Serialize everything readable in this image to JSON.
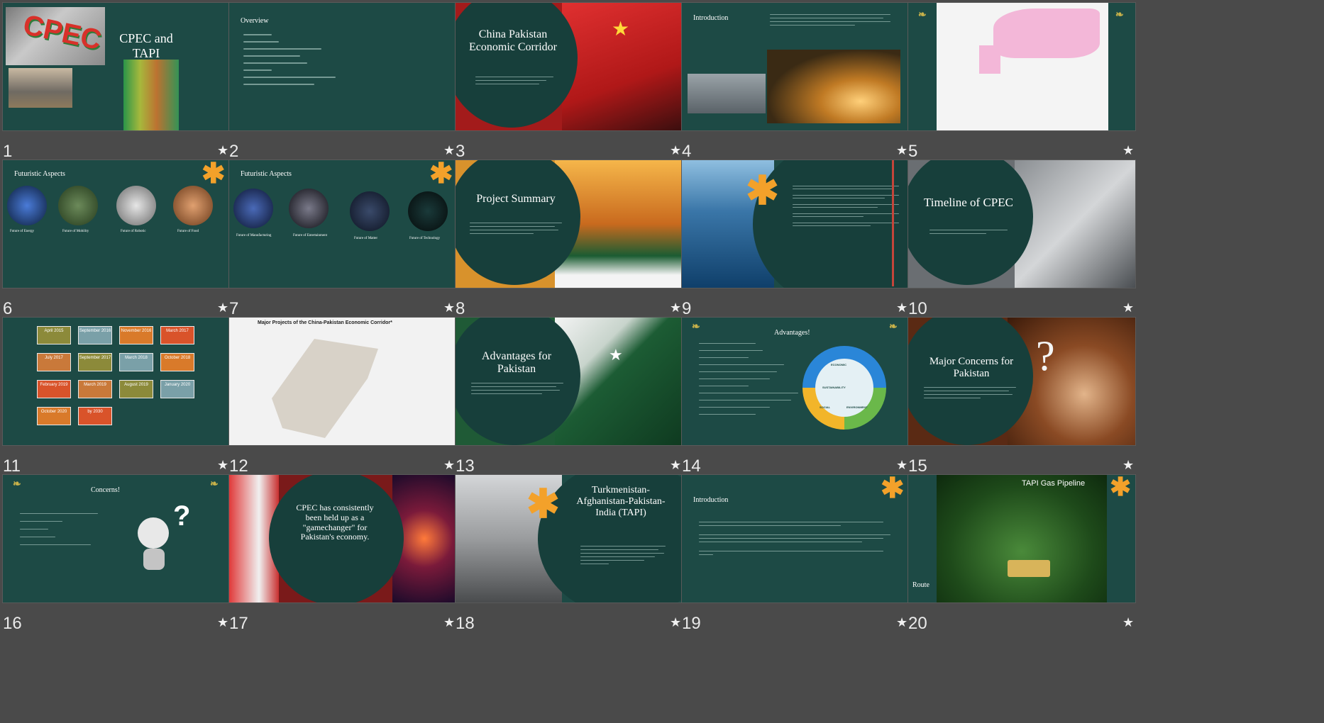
{
  "slides": [
    {
      "num": "1",
      "title": "CPEC and TAPI"
    },
    {
      "num": "2",
      "title": "Overview"
    },
    {
      "num": "3",
      "title": "China Pakistan Economic Corridor"
    },
    {
      "num": "4",
      "title": "Introduction"
    },
    {
      "num": "5",
      "title": ""
    },
    {
      "num": "6",
      "title": "Futuristic Aspects"
    },
    {
      "num": "7",
      "title": "Futuristic Aspects"
    },
    {
      "num": "8",
      "title": "Project Summary"
    },
    {
      "num": "9",
      "title": ""
    },
    {
      "num": "10",
      "title": "Timeline of CPEC"
    },
    {
      "num": "11",
      "title": ""
    },
    {
      "num": "12",
      "title": "Major Projects of the China-Pakistan Economic Corridor*"
    },
    {
      "num": "13",
      "title": "Advantages for Pakistan"
    },
    {
      "num": "14",
      "title": "Advantages!"
    },
    {
      "num": "15",
      "title": "Major Concerns for Pakistan"
    },
    {
      "num": "16",
      "title": "Concerns!"
    },
    {
      "num": "17",
      "title": "CPEC has consistently been held up as a \"gamechanger\" for Pakistan's economy."
    },
    {
      "num": "18",
      "title": "Turkmenistan-Afghanistan-Pakistan-India (TAPI)"
    },
    {
      "num": "19",
      "title": "Introduction"
    },
    {
      "num": "20",
      "title": "TAPI Gas Pipeline"
    }
  ],
  "slide6_labels": [
    "Future of Energy",
    "Future of Mobility",
    "Future of Robotic",
    "Future of Food"
  ],
  "slide7_labels": [
    "Future of Manufacturing",
    "Future of Entertainment",
    "Future of Matter",
    "Future of Technology"
  ],
  "slide20_route": "Route",
  "slide1_cpec_logo": "CPEC",
  "slide11_timeline": [
    "April 2015",
    "September 2016",
    "November 2016",
    "March 2017",
    "July 2017",
    "September 2017",
    "March 2018",
    "October 2018",
    "February 2019",
    "March 2019",
    "August 2019",
    "January 2020",
    "October 2020",
    "by 2030"
  ],
  "slide14_wheel": [
    "ECONOMIC",
    "SUSTAINABILITY",
    "SOCIAL",
    "ENVIRONMENT"
  ],
  "star_icon": "★",
  "colors": {
    "background": "#4a4a4a",
    "slide": "#1d4a45",
    "accent": "#f3a12a",
    "selection": "#c4453a"
  }
}
